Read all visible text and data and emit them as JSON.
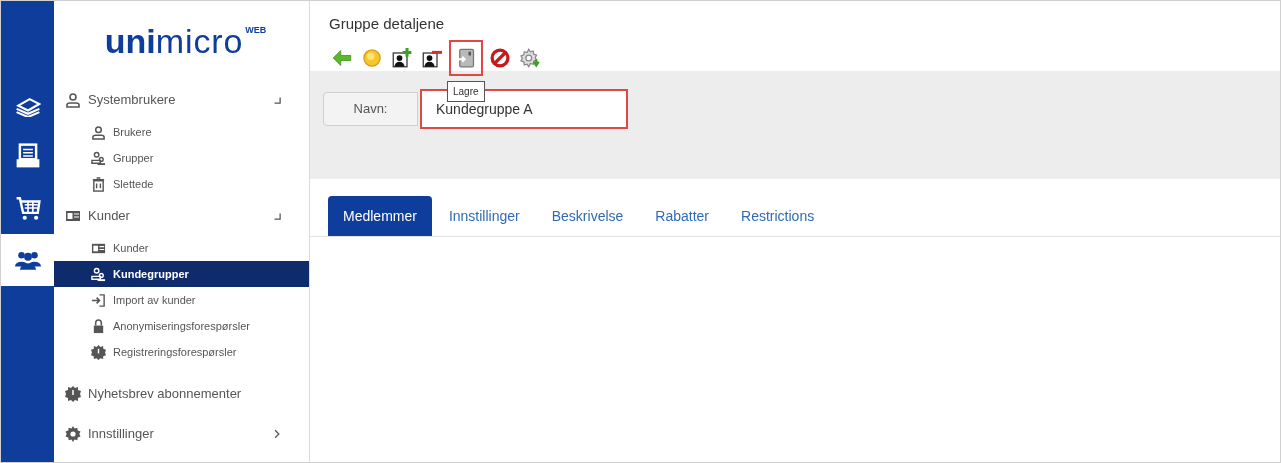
{
  "logo": {
    "bold": "uni",
    "light": "micro",
    "suffix": "WEB"
  },
  "rail": [
    {
      "kind": "papers",
      "selected": false
    },
    {
      "kind": "drawer",
      "selected": false
    },
    {
      "kind": "cart",
      "selected": false
    },
    {
      "kind": "people",
      "selected": true
    }
  ],
  "nav": [
    {
      "label": "Systembrukere",
      "kind": "user",
      "expanded": true,
      "children": [
        {
          "label": "Brukere",
          "kind": "user",
          "selected": false
        },
        {
          "label": "Grupper",
          "kind": "group",
          "selected": false
        },
        {
          "label": "Slettede",
          "kind": "trash",
          "selected": false
        }
      ]
    },
    {
      "label": "Kunder",
      "kind": "card",
      "expanded": true,
      "children": [
        {
          "label": "Kunder",
          "kind": "card",
          "selected": false
        },
        {
          "label": "Kundegrupper",
          "kind": "group",
          "selected": true
        },
        {
          "label": "Import av kunder",
          "kind": "import",
          "selected": false
        },
        {
          "label": "Anonymiseringsforespørsler",
          "kind": "lock",
          "selected": false
        },
        {
          "label": "Registreringsforespørsler",
          "kind": "badge",
          "selected": false
        }
      ]
    },
    {
      "label": "Nyhetsbrev abonnementer",
      "kind": "badge"
    },
    {
      "label": "Innstillinger",
      "kind": "cog",
      "expanded": false
    }
  ],
  "page": {
    "title": "Gruppe detaljene",
    "toolbar": [
      {
        "kind": "back",
        "highlighted": false
      },
      {
        "kind": "sun",
        "highlighted": false
      },
      {
        "kind": "add-user",
        "highlighted": false
      },
      {
        "kind": "remove-user",
        "highlighted": false
      },
      {
        "kind": "save",
        "highlighted": true,
        "tooltip": "Lagre"
      },
      {
        "kind": "cancel",
        "highlighted": false
      },
      {
        "kind": "settings",
        "highlighted": false
      }
    ],
    "field": {
      "label": "Navn:",
      "value": "Kundegruppe A",
      "highlighted": true
    },
    "tabs": [
      {
        "label": "Medlemmer",
        "selected": true
      },
      {
        "label": "Innstillinger",
        "selected": false
      },
      {
        "label": "Beskrivelse",
        "selected": false
      },
      {
        "label": "Rabatter",
        "selected": false
      },
      {
        "label": "Restrictions",
        "selected": false
      }
    ]
  }
}
